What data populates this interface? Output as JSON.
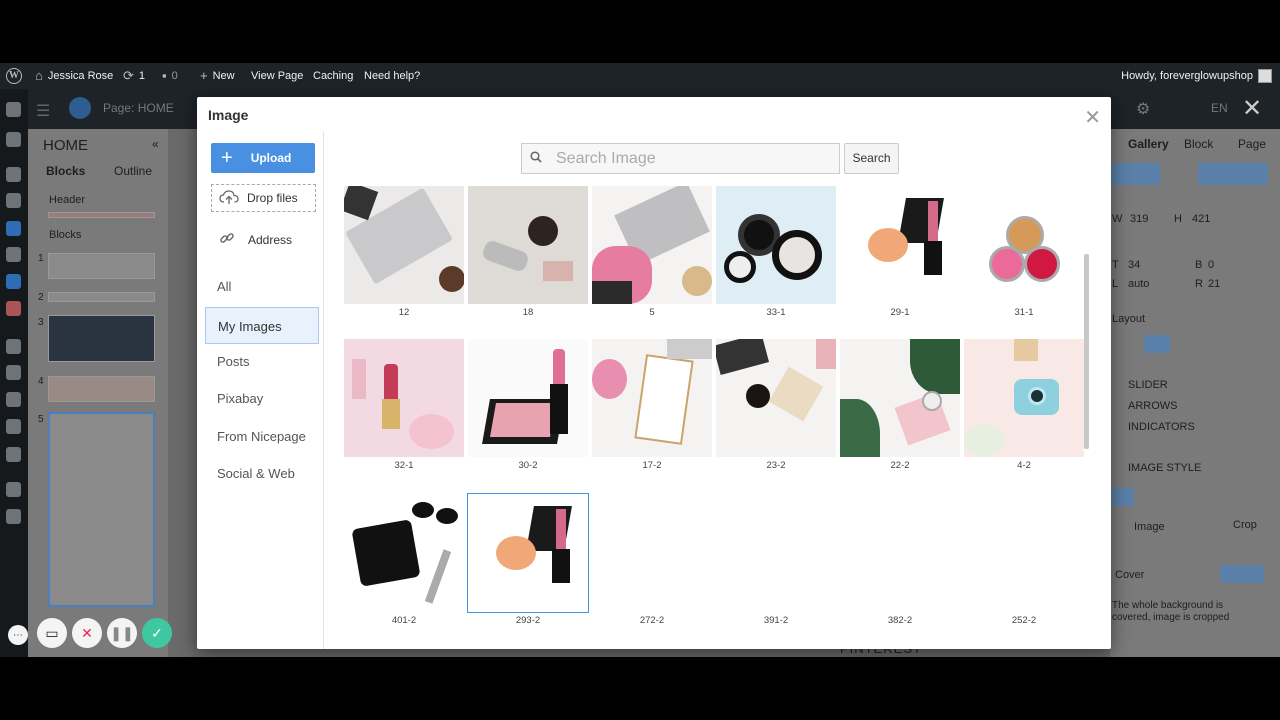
{
  "adminbar": {
    "site_name": "Jessica Rose",
    "updates_count": "1",
    "comments_count": "0",
    "new_label": "New",
    "view_page": "View Page",
    "caching": "Caching",
    "need_help": "Need help?",
    "howdy": "Howdy, foreverglowupshop"
  },
  "editor": {
    "page_label": "Page: HOME",
    "lang": "EN",
    "left_panel": {
      "title": "HOME",
      "tabs": [
        "Blocks",
        "Outline"
      ],
      "header_label": "Header",
      "blocks_label": "Blocks",
      "block_numbers": [
        "1",
        "2",
        "3",
        "4",
        "5"
      ]
    },
    "right_panel": {
      "tabs": [
        "Gallery",
        "Block",
        "Page"
      ],
      "w_label": "W",
      "w_value": "319",
      "h_label": "H",
      "h_value": "421",
      "t_label": "T",
      "t_value": "34",
      "b_label": "B",
      "b_value": "0",
      "l_label": "L",
      "l_value": "auto",
      "r_label": "R",
      "r_value": "21",
      "layout_label": "Layout",
      "slider_label": "SLIDER",
      "arrows_label": "ARROWS",
      "indicators_label": "INDICATORS",
      "image_style_label": "IMAGE STYLE",
      "image_label": "Image",
      "crop_label": "Crop",
      "cover_label": "Cover",
      "cover_help": "The whole background is covered, image is cropped"
    },
    "canvas_text": "PINTEREST"
  },
  "modal": {
    "title": "Image",
    "upload_label": "Upload",
    "drop_label": "Drop files",
    "address_label": "Address",
    "categories": [
      "All",
      "My Images",
      "Posts",
      "Pixabay",
      "From Nicepage",
      "Social & Web"
    ],
    "active_category": "My Images",
    "search_placeholder": "Search Image",
    "search_button": "Search",
    "images": [
      "12",
      "18",
      "5",
      "33-1",
      "29-1",
      "31-1",
      "32-1",
      "30-2",
      "17-2",
      "23-2",
      "22-2",
      "4-2",
      "401-2",
      "293-2",
      "272-2",
      "391-2",
      "382-2",
      "252-2"
    ],
    "selected_image": "293-2"
  },
  "icons": {
    "wordpress": "wordpress-logo-icon",
    "home": "home-icon",
    "refresh": "updates-icon",
    "comment": "comment-icon",
    "plus": "plus-icon",
    "close": "close-icon",
    "search": "search-icon",
    "cloud": "cloud-upload-icon",
    "link": "link-icon"
  },
  "colors": {
    "accent": "#4a90e2",
    "adminbar": "#1d2327",
    "confirm": "#3ec7a0"
  }
}
